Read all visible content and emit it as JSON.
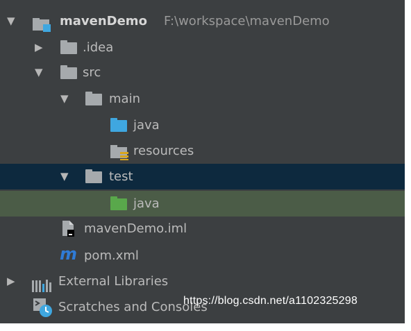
{
  "tree": {
    "root": {
      "name": "mavenDemo",
      "path": "F:\\workspace\\mavenDemo"
    },
    "idea": ".idea",
    "src": "src",
    "main": "main",
    "main_java": "java",
    "resources": "resources",
    "test": "test",
    "test_java": "java",
    "iml": "mavenDemo.iml",
    "pom_icon": "m",
    "pom": "pom.xml",
    "libraries": "External Libraries",
    "scratches": "Scratches and Consoles"
  },
  "arrows": {
    "expanded": "▼",
    "collapsed": "▶"
  },
  "watermark": "https://blog.csdn.net/a1102325298",
  "colors": {
    "panel_bg": "#3c3f41",
    "selected_bg": "#0d293e",
    "highlight_bg": "#4b5c47",
    "source_folder": "#3fa7e0",
    "test_folder": "#59a84b",
    "pom_icon": "#2f7bd6"
  }
}
